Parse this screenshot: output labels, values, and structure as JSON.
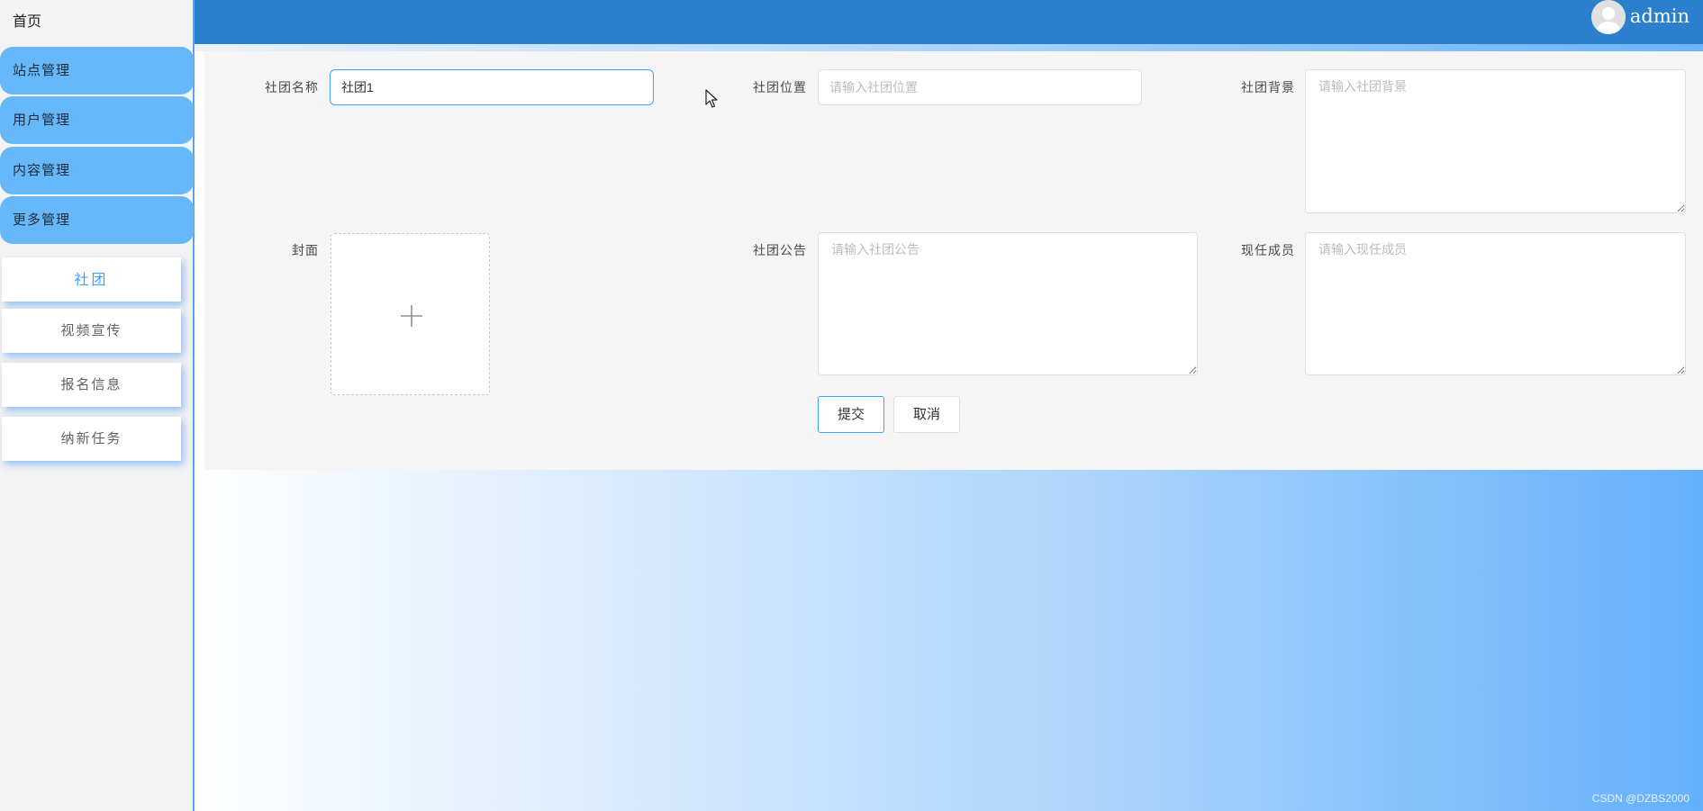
{
  "header": {
    "username": "admin",
    "avatar_icon": "user-avatar-icon",
    "color": "#2b7fcc"
  },
  "sidebar": {
    "home": "首页",
    "groups": [
      {
        "label": "站点管理"
      },
      {
        "label": "用户管理"
      },
      {
        "label": "内容管理"
      },
      {
        "label": "更多管理"
      }
    ],
    "sub_items": [
      {
        "label": "社团",
        "active": true
      },
      {
        "label": "视频宣传",
        "active": false
      },
      {
        "label": "报名信息",
        "active": false
      },
      {
        "label": "纳新任务",
        "active": false
      }
    ]
  },
  "form": {
    "name": {
      "label": "社团名称",
      "value": "社团1"
    },
    "location": {
      "label": "社团位置",
      "placeholder": "请输入社团位置"
    },
    "background": {
      "label": "社团背景",
      "placeholder": "请输入社团背景"
    },
    "cover": {
      "label": "封面",
      "icon": "plus-icon"
    },
    "notice": {
      "label": "社团公告",
      "placeholder": "请输入社团公告"
    },
    "members": {
      "label": "现任成员",
      "placeholder": "请输入现任成员"
    },
    "submit": "提交",
    "cancel": "取消"
  },
  "watermark": "CSDN @DZBS2000",
  "colors": {
    "accent": "#409eff",
    "menu_group": "#66b8fb",
    "panel": "#f5f5f5"
  }
}
